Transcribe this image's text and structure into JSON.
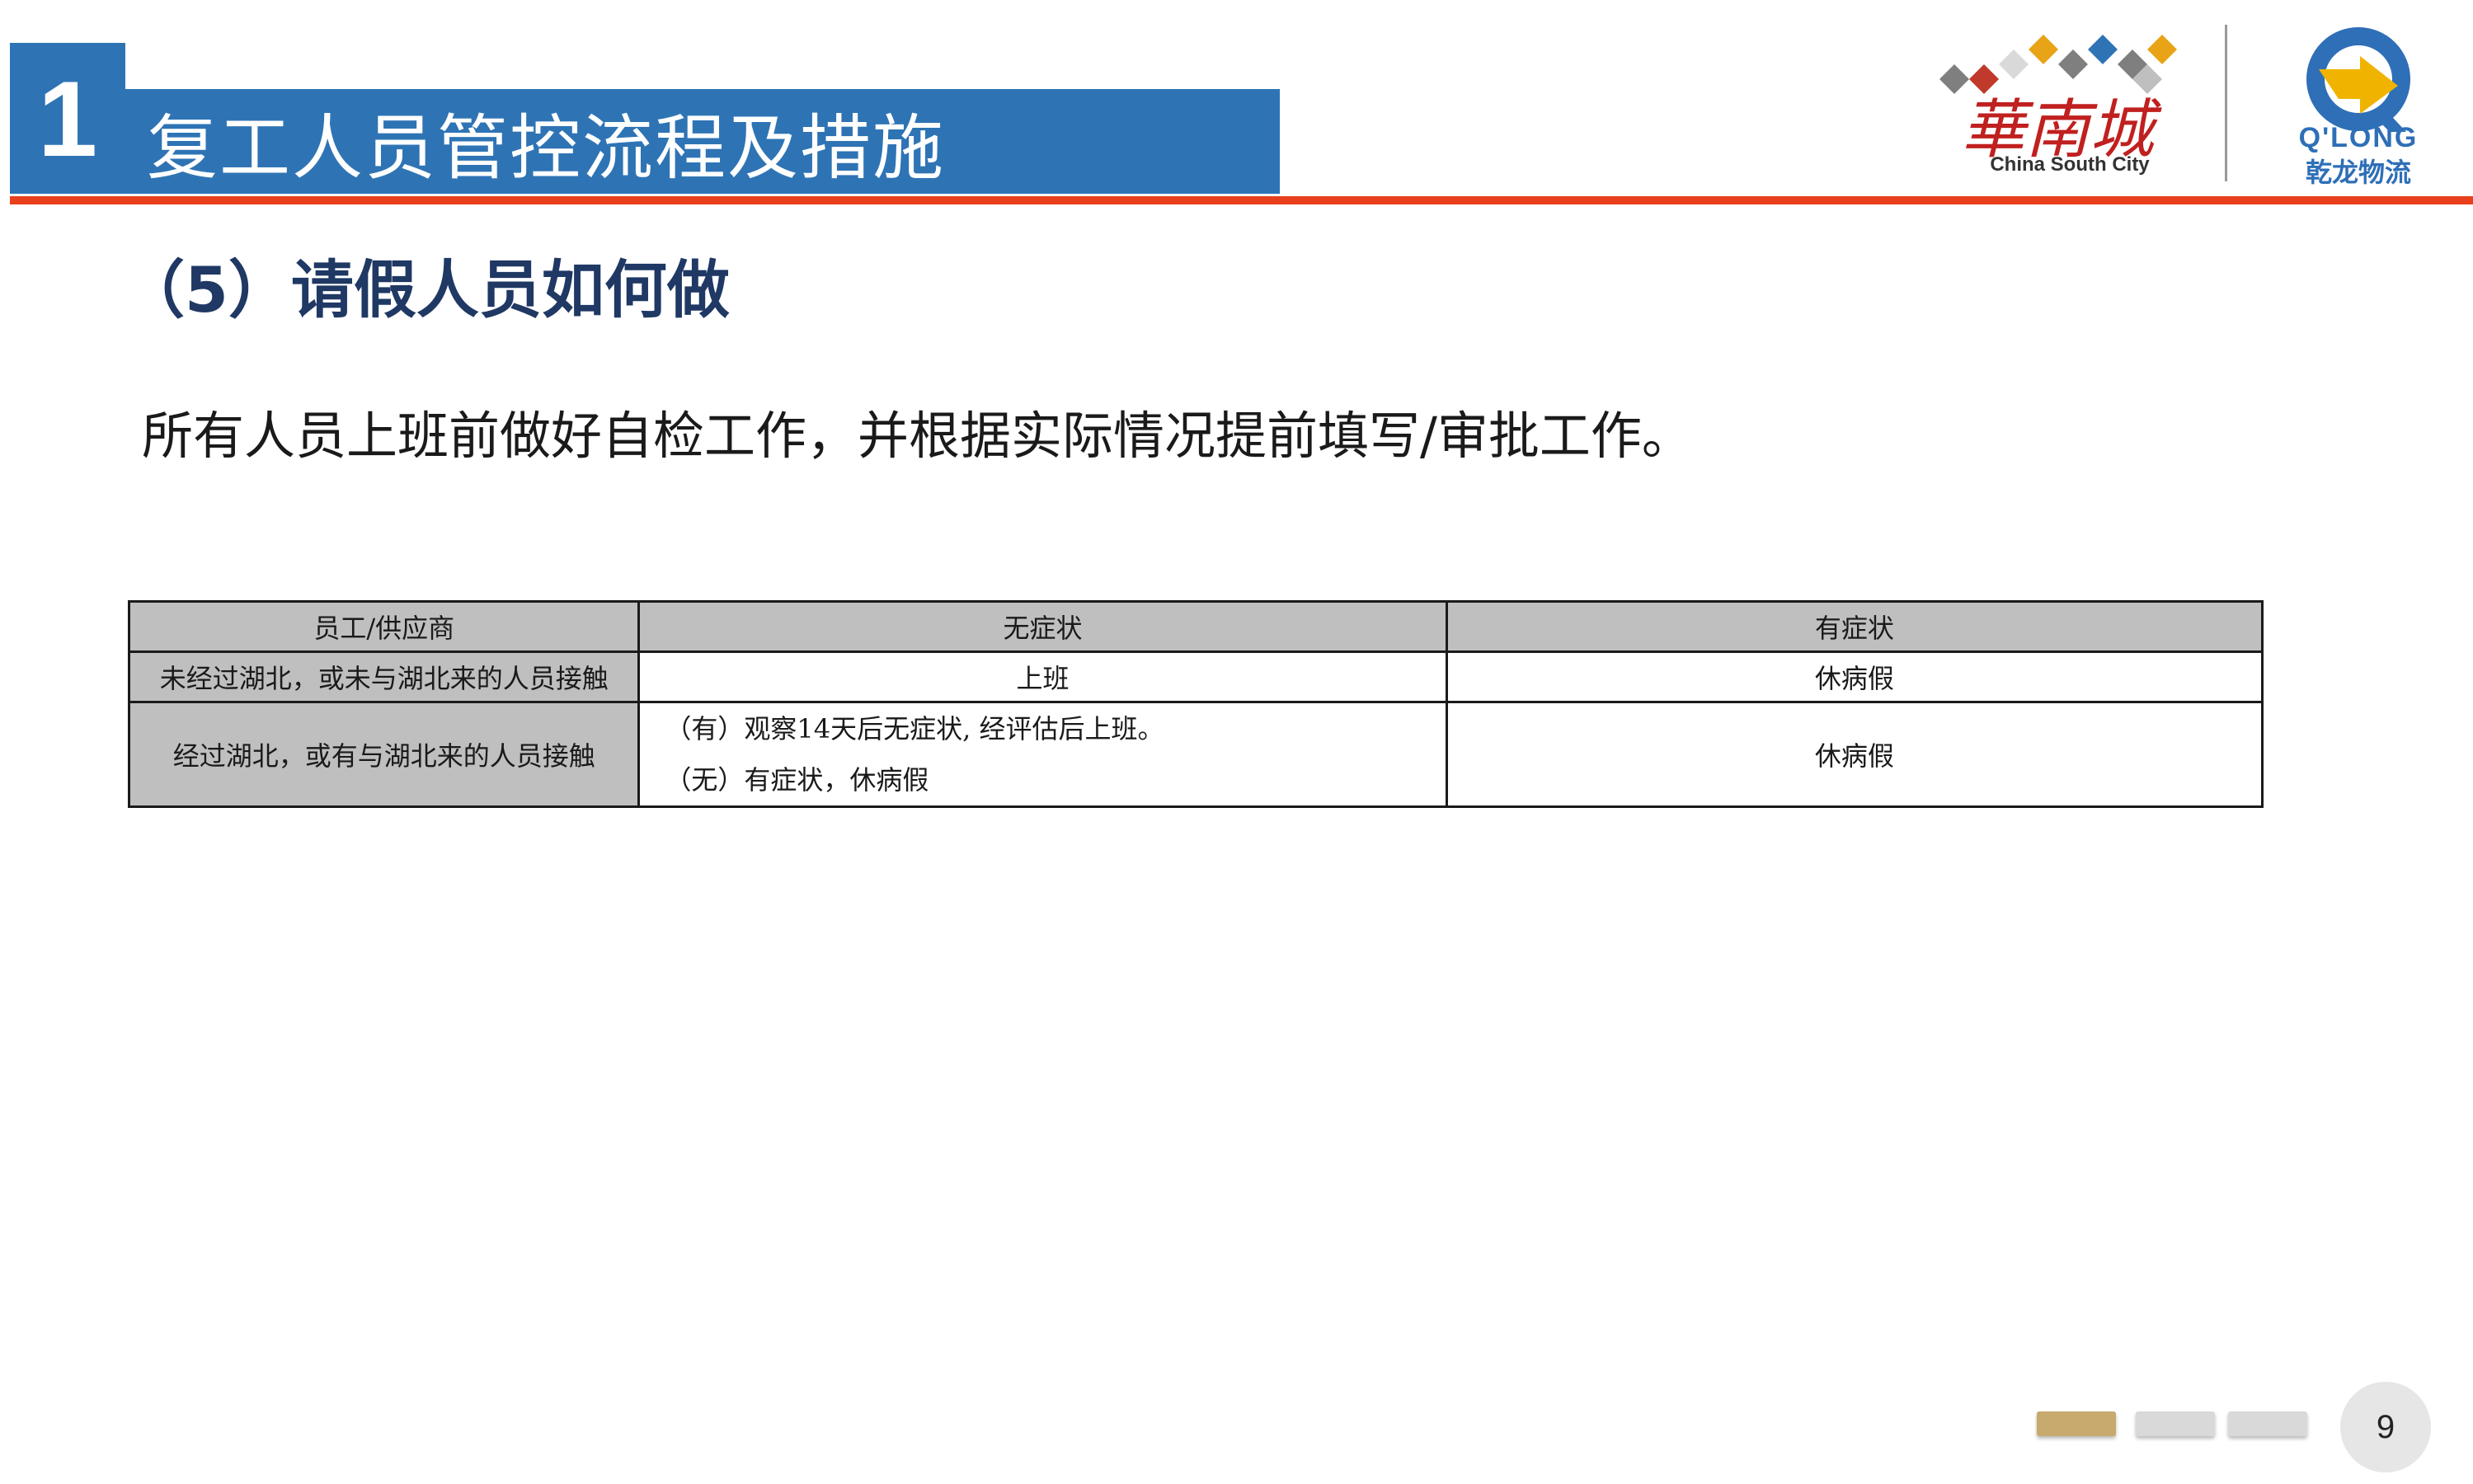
{
  "header": {
    "section_number": "1",
    "title": "复工人员管控流程及措施"
  },
  "logos": {
    "csc_name_cn": "華南城",
    "csc_name_en": "China South City",
    "qlong_name_en": "Q'LONG",
    "qlong_name_cn": "乾龙物流"
  },
  "subtitle": "（5）请假人员如何做",
  "lead": "所有人员上班前做好自检工作，并根据实际情况提前填写/审批工作。",
  "table": {
    "headers": [
      "员工/供应商",
      "无症状",
      "有症状"
    ],
    "rows": [
      {
        "category": "未经过湖北，或未与湖北来的人员接触",
        "no_symptom": "上班",
        "symptom": "休病假"
      },
      {
        "category": "经过湖北，或有与湖北来的人员接触",
        "no_symptom_lines": [
          "（有）观察14天后无症状, 经评估后上班。",
          "（无）有症状，休病假"
        ],
        "symptom": "休病假"
      }
    ]
  },
  "footer": {
    "page_number": "9"
  },
  "colors": {
    "title_blue": "#2e74b5",
    "rule_red": "#e8401c",
    "subtitle_navy": "#1f3864",
    "header_gray": "#bfbfbf",
    "pager_gold": "#c8a96e"
  }
}
